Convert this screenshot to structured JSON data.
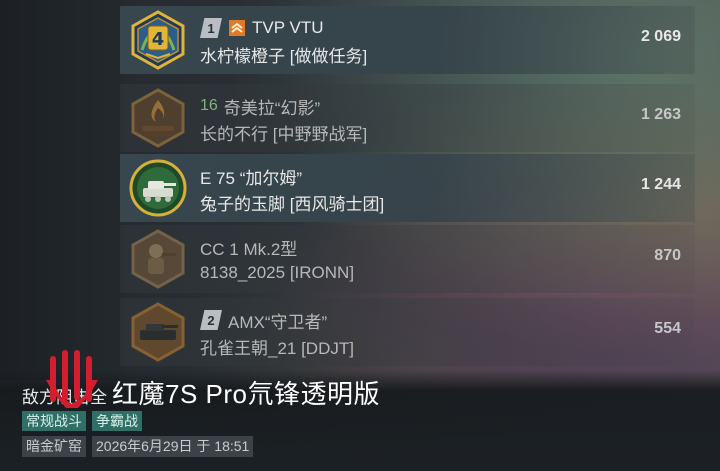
{
  "players": [
    {
      "rank": "1",
      "rank_style": "silver",
      "has_chevron": true,
      "tank": "TVP VTU",
      "name": "水柠檬橙子 [做做任务]",
      "score": "2 069",
      "badge_icon": "tier-4-badge-icon",
      "badge_text": "4",
      "highlight": true
    },
    {
      "rank": "16",
      "rank_style": "green",
      "has_chevron": false,
      "tank": "奇美拉“幻影”",
      "name": "长的不行 [中野野战军]",
      "score": "1 263",
      "badge_icon": "campfire-badge-icon",
      "highlight": false
    },
    {
      "rank": "",
      "rank_style": "none",
      "has_chevron": false,
      "tank": "E 75 “加尔姆”",
      "name": "兔子的玉脚 [西风骑士团]",
      "score": "1 244",
      "badge_icon": "tank-badge-icon",
      "highlight": true
    },
    {
      "rank": "",
      "rank_style": "none",
      "has_chevron": false,
      "tank": "CC 1 Mk.2型",
      "name": "8138_2025 [IRONN]",
      "score": "870",
      "badge_icon": "soldier-badge-icon",
      "highlight": false
    },
    {
      "rank": "2",
      "rank_style": "silver",
      "has_chevron": false,
      "tank": "AMX“守卫者”",
      "name": "孔雀王朝_21 [DDJT]",
      "score": "554",
      "badge_icon": "tank-destroyer-badge-icon",
      "highlight": false
    }
  ],
  "footer": {
    "result_label": "敌方阻击全",
    "watermark": "红魔7S Pro氘锋透明版",
    "tags": [
      "常规战斗",
      "争霸战"
    ],
    "map": "暗金矿窑",
    "datetime": "2026年6月29日 于 18:51"
  },
  "colors": {
    "highlight_row": "#3a4a52",
    "gold_badge": "#d7a02a",
    "tag_teal": "#2f6f66",
    "watermark_red": "#d21e2e"
  }
}
